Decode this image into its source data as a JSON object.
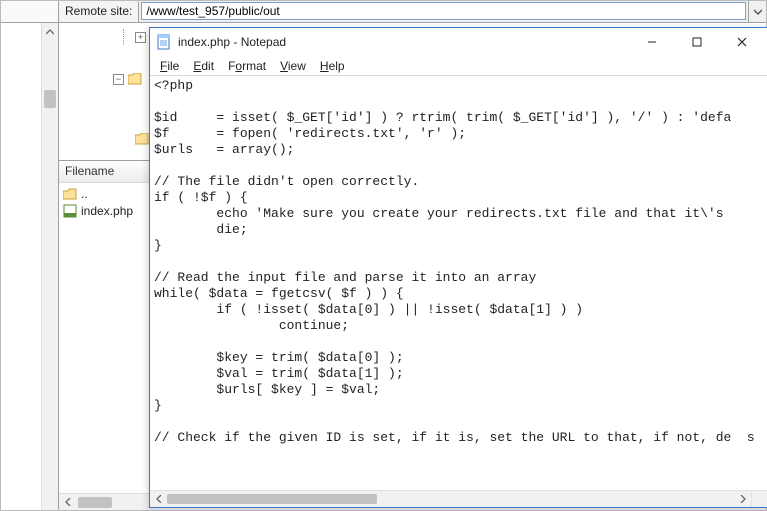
{
  "remote_bar": {
    "label": "Remote site:",
    "path": "/www/test_957/public/out"
  },
  "tree": {
    "items": []
  },
  "file_panel": {
    "header": "Filename",
    "rows": [
      {
        "name": "..",
        "kind": "up"
      },
      {
        "name": "index.php",
        "kind": "php"
      }
    ]
  },
  "notepad": {
    "title": "index.php - Notepad",
    "menus": {
      "file": {
        "ul": "F",
        "rest": "ile"
      },
      "edit": {
        "ul": "E",
        "rest": "dit"
      },
      "format": {
        "ul": "o",
        "pre": "F",
        "rest": "rmat"
      },
      "view": {
        "ul": "V",
        "rest": "iew"
      },
      "help": {
        "ul": "H",
        "rest": "elp"
      }
    },
    "code_lines": [
      "<?php",
      "",
      "$id     = isset( $_GET['id'] ) ? rtrim( trim( $_GET['id'] ), '/' ) : 'defa",
      "$f      = fopen( 'redirects.txt', 'r' );",
      "$urls   = array();",
      "",
      "// The file didn't open correctly.",
      "if ( !$f ) {",
      "        echo 'Make sure you create your redirects.txt file and that it\\'s ",
      "        die;",
      "}",
      "",
      "// Read the input file and parse it into an array",
      "while( $data = fgetcsv( $f ) ) {",
      "        if ( !isset( $data[0] ) || !isset( $data[1] ) )",
      "                continue;",
      "",
      "        $key = trim( $data[0] );",
      "        $val = trim( $data[1] );",
      "        $urls[ $key ] = $val;",
      "}",
      "",
      "// Check if the given ID is set, if it is, set the URL to that, if not, de  s"
    ]
  }
}
